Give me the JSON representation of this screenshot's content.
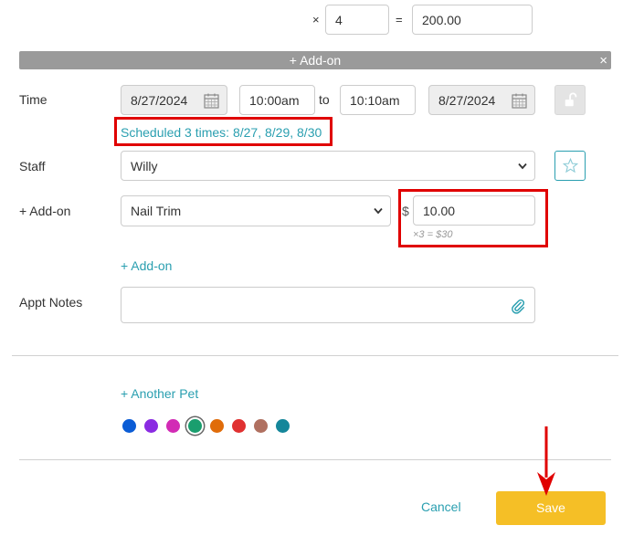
{
  "price_calc": {
    "multiply_sign": "×",
    "quantity": "4",
    "equals_sign": "=",
    "total": "200.00"
  },
  "addon_bar": {
    "label": "+ Add-on",
    "close": "×"
  },
  "time": {
    "label": "Time",
    "start_date": "8/27/2024",
    "start_time": "10:00am",
    "to_label": "to",
    "end_time": "10:10am",
    "end_date": "8/27/2024",
    "scheduled_text": "Scheduled 3 times: 8/27, 8/29, 8/30"
  },
  "staff": {
    "label": "Staff",
    "selected": "Willy"
  },
  "addon": {
    "label": "+ Add-on",
    "selected": "Nail Trim",
    "currency": "$",
    "price": "10.00",
    "multiplier_note": "×3 = $30",
    "add_link": "+ Add-on"
  },
  "notes": {
    "label": "Appt Notes",
    "value": ""
  },
  "pet": {
    "another_link": "+ Another Pet",
    "colors": [
      "#0b5cd5",
      "#8a2be2",
      "#d22bb5",
      "#1a9e6e",
      "#e06c0a",
      "#e03131",
      "#b07060",
      "#15869a"
    ],
    "selected_color_index": 3
  },
  "footer": {
    "cancel_label": "Cancel",
    "save_label": "Save"
  },
  "accent": {
    "link": "#2a9fb0",
    "save": "#f5bf26",
    "annotation": "#e00000"
  }
}
